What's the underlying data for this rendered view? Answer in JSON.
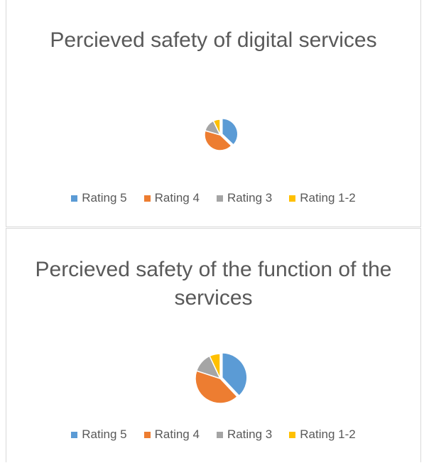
{
  "chart_data": [
    {
      "type": "pie",
      "title": "Percieved safety of digital services",
      "categories": [
        "Rating 5",
        "Rating 4",
        "Rating 3",
        "Rating 1-2"
      ],
      "values": [
        36,
        41,
        13,
        7
      ],
      "colors": [
        "#5b9bd5",
        "#ed7d31",
        "#a5a5a5",
        "#ffc000"
      ],
      "exploded_slice": 0,
      "legend": "bottom"
    },
    {
      "type": "pie",
      "title": "Percieved safety of the function of the services",
      "categories": [
        "Rating 5",
        "Rating 4",
        "Rating 3",
        "Rating 1-2"
      ],
      "values": [
        38,
        42,
        13,
        7
      ],
      "colors": [
        "#5b9bd5",
        "#ed7d31",
        "#a5a5a5",
        "#ffc000"
      ],
      "exploded_slice": 0,
      "legend": "bottom"
    }
  ]
}
